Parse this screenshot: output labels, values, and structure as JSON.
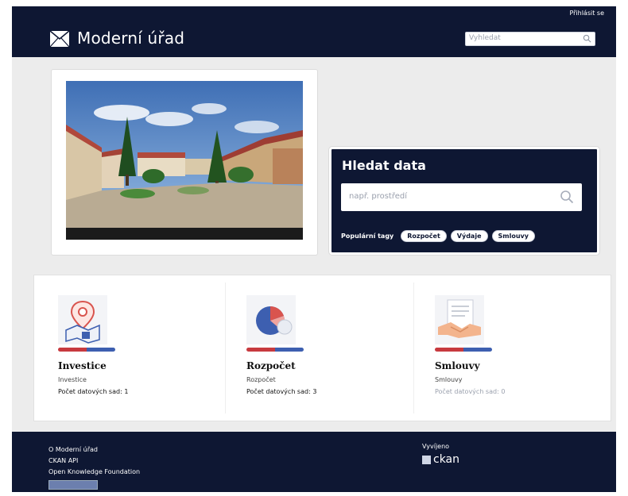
{
  "header": {
    "login": "Přihlásit se",
    "title": "Moderní úřad",
    "search_placeholder": "Vyhledat"
  },
  "hero": {
    "heading": "Hledat data",
    "search_placeholder": "např. prostředí",
    "tags_label": "Populární tagy",
    "tags": [
      "Rozpočet",
      "Výdaje",
      "Smlouvy"
    ]
  },
  "categories": [
    {
      "title": "Investice",
      "subtitle": "Investice",
      "count": "Počet datových sad: 1"
    },
    {
      "title": "Rozpočet",
      "subtitle": "Rozpočet",
      "count": "Počet datových sad: 3"
    },
    {
      "title": "Smlouvy",
      "subtitle": "Smlouvy",
      "count": "Počet datových sad: 0"
    }
  ],
  "footer": {
    "links": [
      "O Moderní úřad",
      "CKAN API",
      "Open Knowledge Foundation"
    ],
    "powered_by": "Vyvíjeno",
    "ckan": "ckan"
  },
  "colors": {
    "navy": "#0e1733",
    "accent_red": "#c73a3f",
    "accent_blue": "#3d5fb0"
  }
}
